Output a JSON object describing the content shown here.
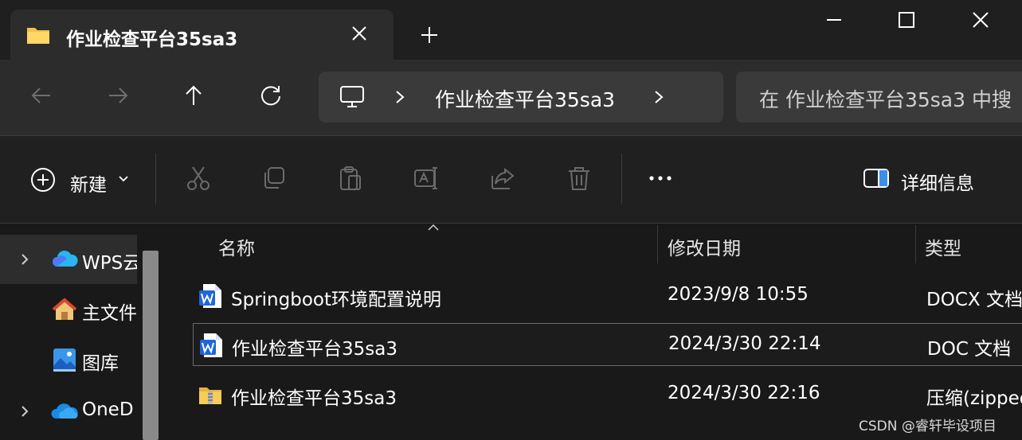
{
  "tab": {
    "title": "作业检查平台35sa3",
    "icon": "folder-icon"
  },
  "address_bar": {
    "crumb": "作业检查平台35sa3",
    "root_icon": "this-pc-icon"
  },
  "search": {
    "placeholder": "在 作业检查平台35sa3 中搜"
  },
  "toolbar": {
    "new_label": "新建",
    "details_label": "详细信息",
    "icons": [
      "cut-icon",
      "copy-icon",
      "paste-icon",
      "rename-icon",
      "share-icon",
      "delete-icon",
      "more-icon"
    ]
  },
  "sidebar": {
    "items": [
      {
        "label": "WPS云",
        "icon": "wps-cloud-icon",
        "expandable": true,
        "selected": true
      },
      {
        "label": "主文件",
        "icon": "home-icon",
        "expandable": false,
        "selected": false
      },
      {
        "label": "图库",
        "icon": "gallery-icon",
        "expandable": false,
        "selected": false
      },
      {
        "label": "OneD",
        "icon": "onedrive-icon",
        "expandable": true,
        "selected": false
      }
    ]
  },
  "columns": {
    "name": "名称",
    "modified": "修改日期",
    "type": "类型"
  },
  "files": [
    {
      "name": "Springboot环境配置说明",
      "modified": "2023/9/8 10:55",
      "type": "DOCX 文档",
      "icon": "word-docx-icon",
      "selected": false
    },
    {
      "name": "作业检查平台35sa3",
      "modified": "2024/3/30 22:14",
      "type": "DOC 文档",
      "icon": "word-doc-icon",
      "selected": true
    },
    {
      "name": "作业检查平台35sa3",
      "modified": "2024/3/30 22:16",
      "type": "压缩(zipped)",
      "icon": "zip-folder-icon",
      "selected": false
    }
  ],
  "watermark": "CSDN @睿轩毕设项目",
  "colors": {
    "background": "#191919",
    "toolbar": "#202020",
    "navbar": "#2c2c2c",
    "accent_blue": "#3b8eea",
    "folder_yellow": "#f4c24a"
  }
}
